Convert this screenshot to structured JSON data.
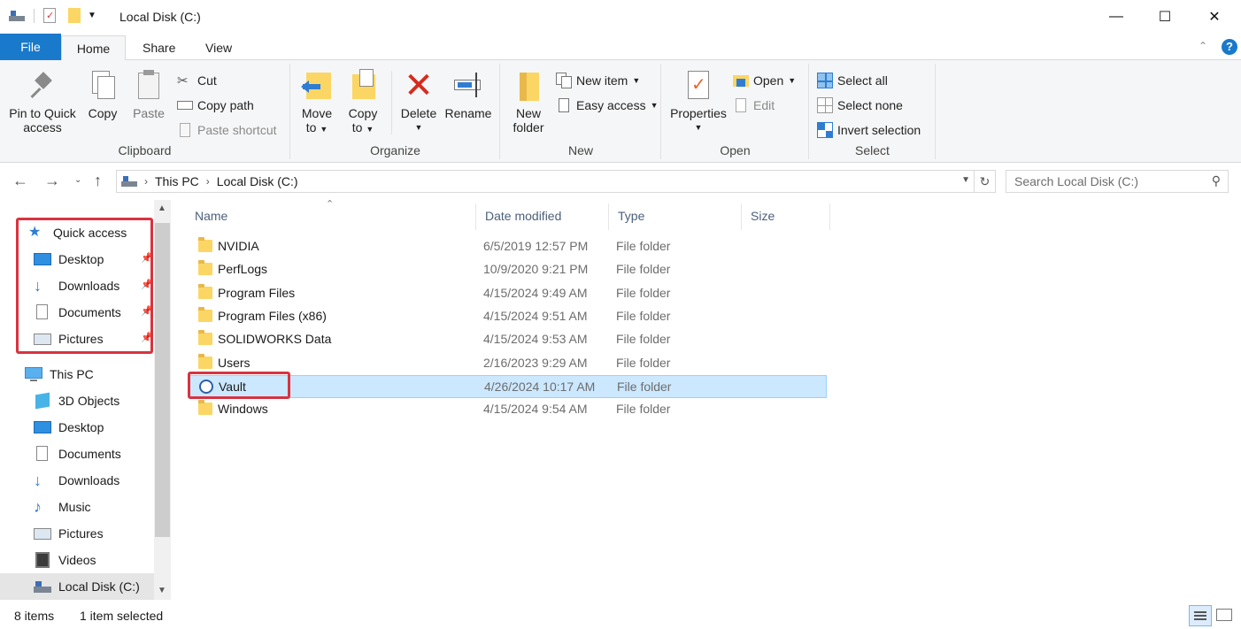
{
  "window": {
    "title": "Local Disk (C:)",
    "controls": {
      "minimize": "—",
      "maximize": "☐",
      "close": "✕"
    }
  },
  "ribbon_tabs": [
    "File",
    "Home",
    "Share",
    "View"
  ],
  "ribbon": {
    "clipboard": {
      "label": "Clipboard",
      "pin": "Pin to Quick\naccess",
      "pin_l1": "Pin to Quick",
      "pin_l2": "access",
      "copy": "Copy",
      "paste": "Paste",
      "cut": "Cut",
      "copy_path": "Copy path",
      "paste_shortcut": "Paste shortcut"
    },
    "organize": {
      "label": "Organize",
      "move_l1": "Move",
      "move_l2": "to",
      "copy_l1": "Copy",
      "copy_l2": "to",
      "delete": "Delete",
      "rename": "Rename"
    },
    "new": {
      "label": "New",
      "folder_l1": "New",
      "folder_l2": "folder",
      "new_item": "New item",
      "easy_access": "Easy access"
    },
    "open": {
      "label": "Open",
      "properties": "Properties",
      "open": "Open",
      "edit": "Edit"
    },
    "select": {
      "label": "Select",
      "select_all": "Select all",
      "select_none": "Select none",
      "invert": "Invert selection"
    }
  },
  "address": {
    "crumbs": [
      "This PC",
      "Local Disk (C:)"
    ],
    "search_placeholder": "Search Local Disk (C:)"
  },
  "navpane": {
    "quick_access": "Quick access",
    "quick_items": [
      "Desktop",
      "Downloads",
      "Documents",
      "Pictures"
    ],
    "this_pc": "This PC",
    "pc_items": [
      "3D Objects",
      "Desktop",
      "Documents",
      "Downloads",
      "Music",
      "Pictures",
      "Videos",
      "Local Disk (C:)"
    ]
  },
  "columns": [
    "Name",
    "Date modified",
    "Type",
    "Size"
  ],
  "files": [
    {
      "name": "NVIDIA",
      "date": "6/5/2019 12:57 PM",
      "type": "File folder"
    },
    {
      "name": "PerfLogs",
      "date": "10/9/2020 9:21 PM",
      "type": "File folder"
    },
    {
      "name": "Program Files",
      "date": "4/15/2024 9:49 AM",
      "type": "File folder"
    },
    {
      "name": "Program Files (x86)",
      "date": "4/15/2024 9:51 AM",
      "type": "File folder"
    },
    {
      "name": "SOLIDWORKS Data",
      "date": "4/15/2024 9:53 AM",
      "type": "File folder"
    },
    {
      "name": "Users",
      "date": "2/16/2023 9:29 AM",
      "type": "File folder"
    },
    {
      "name": "Vault",
      "date": "4/26/2024 10:17 AM",
      "type": "File folder"
    },
    {
      "name": "Windows",
      "date": "4/15/2024 9:54 AM",
      "type": "File folder"
    }
  ],
  "selected_file": "Vault",
  "status": {
    "count": "8 items",
    "selection": "1 item selected"
  },
  "colors": {
    "accent": "#1979ca",
    "selection": "#cce8ff",
    "highlight": "#d9333f",
    "folder": "#fcd664"
  }
}
